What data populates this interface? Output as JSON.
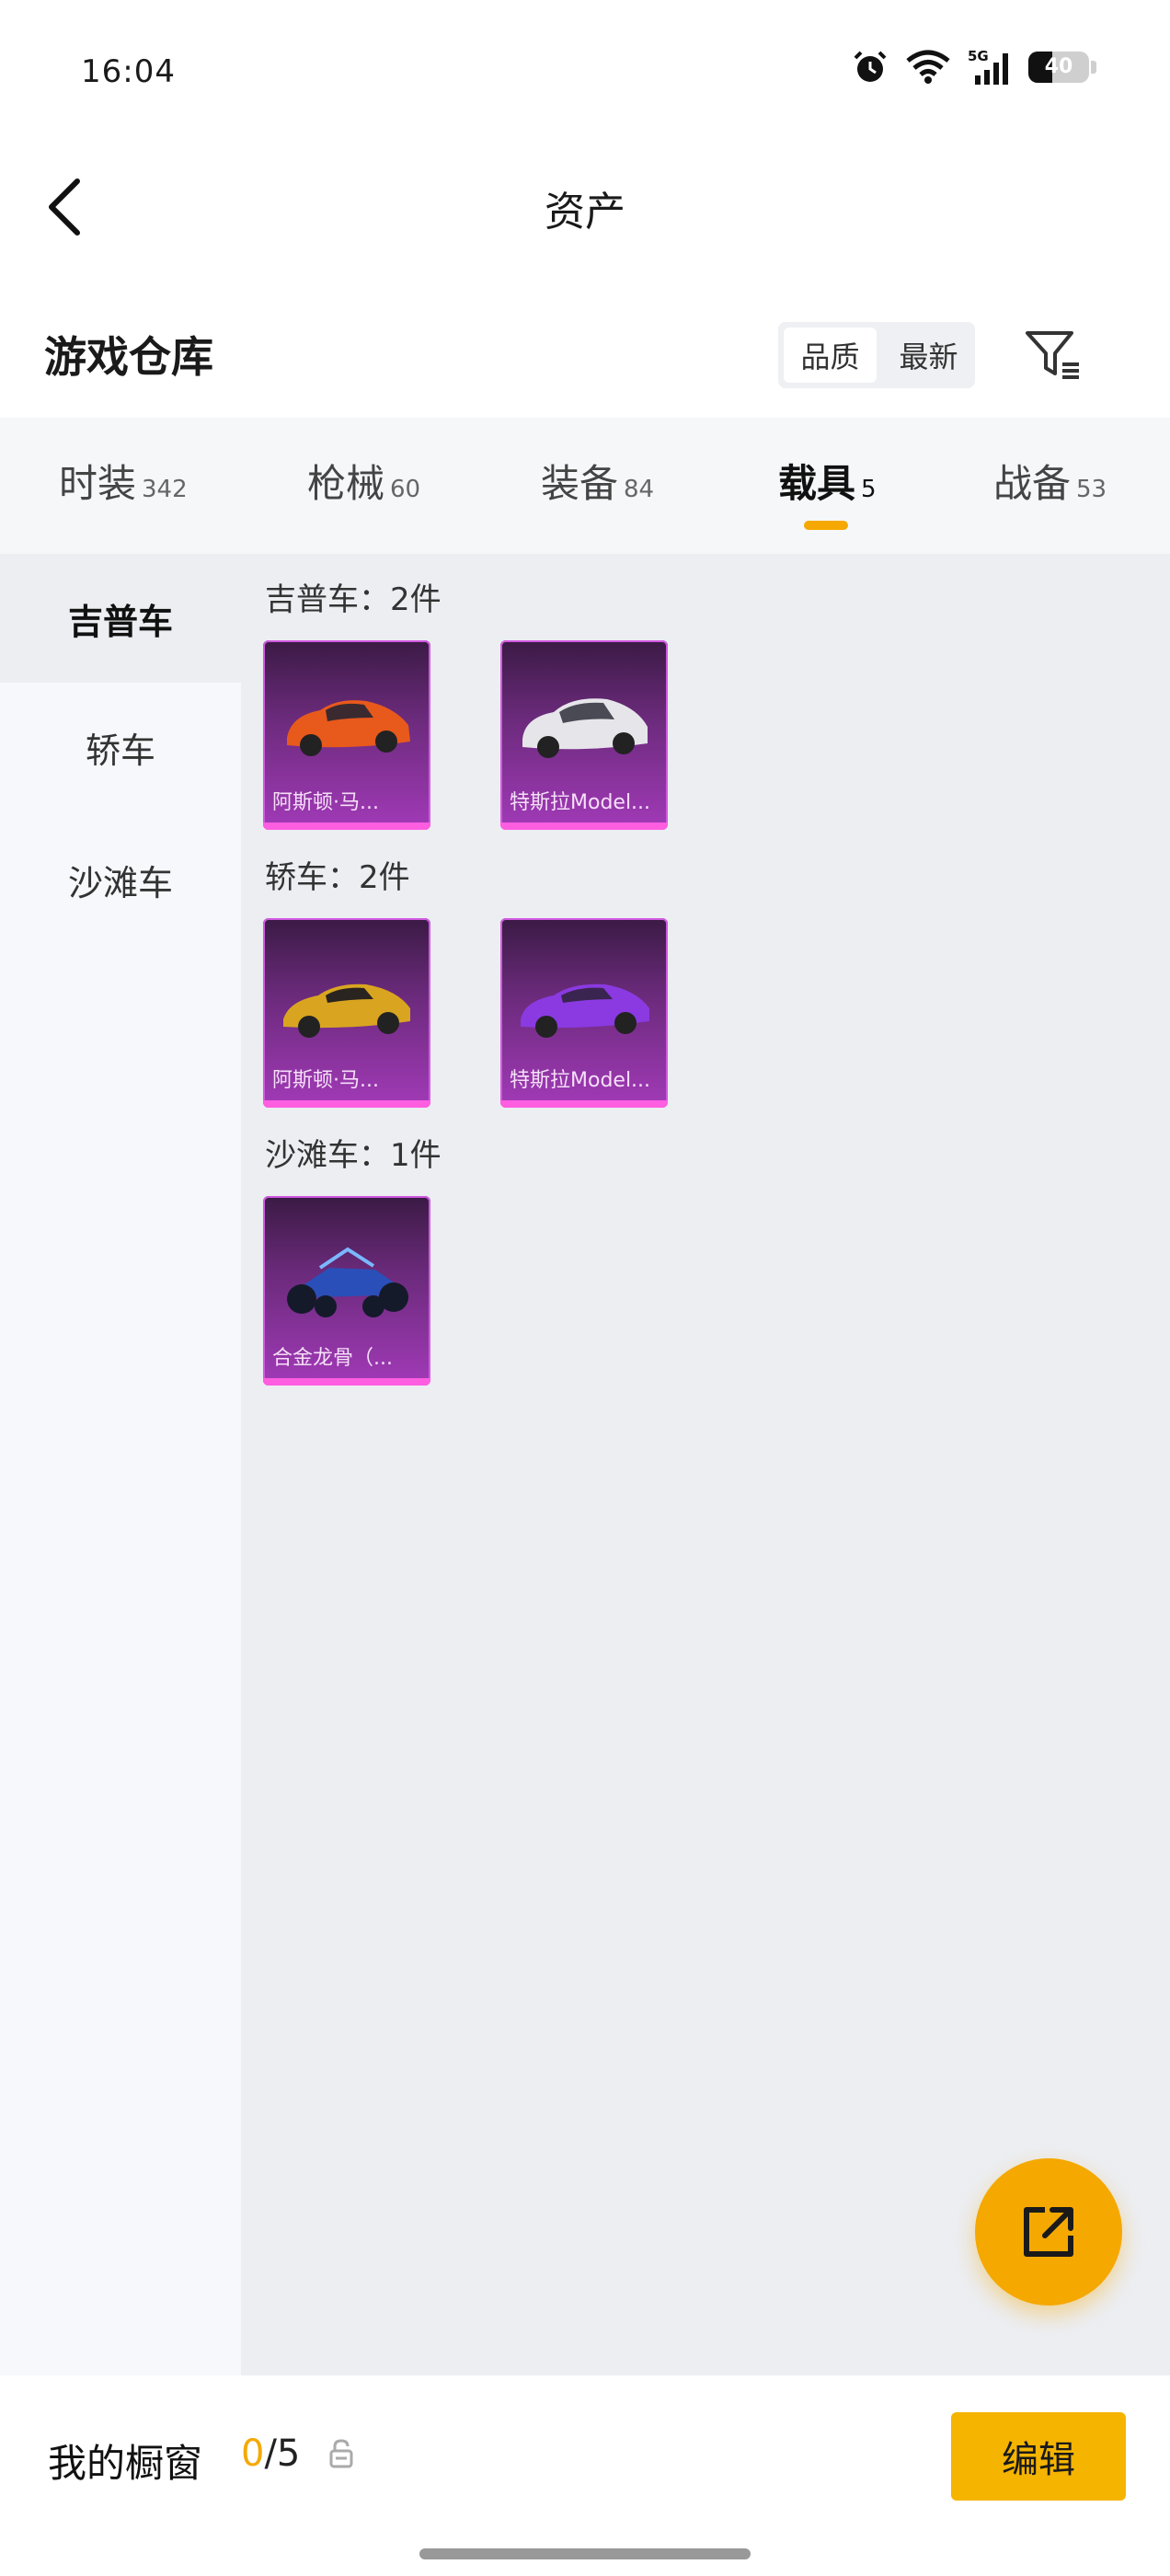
{
  "status": {
    "time": "16:04",
    "battery": "40",
    "network": "5G"
  },
  "header": {
    "title": "资产"
  },
  "warehouse": {
    "title": "游戏仓库",
    "sort_options": [
      "品质",
      "最新"
    ],
    "sort_selected": "品质"
  },
  "tabs": [
    {
      "label": "时装",
      "count": "342"
    },
    {
      "label": "枪械",
      "count": "60"
    },
    {
      "label": "装备",
      "count": "84"
    },
    {
      "label": "载具",
      "count": "5"
    },
    {
      "label": "战备",
      "count": "53"
    }
  ],
  "active_tab": "载具",
  "sidebar": {
    "items": [
      {
        "label": "吉普车"
      },
      {
        "label": "轿车"
      },
      {
        "label": "沙滩车"
      }
    ],
    "active": "吉普车"
  },
  "groups": [
    {
      "title": "吉普车：2件",
      "items": [
        {
          "name": "阿斯顿·马...",
          "icon": "orange-suv-icon",
          "color": "#e8591c"
        },
        {
          "name": "特斯拉Model...",
          "icon": "white-suv-icon",
          "color": "#e6e6ea"
        }
      ]
    },
    {
      "title": "轿车：2件",
      "items": [
        {
          "name": "阿斯顿·马...",
          "icon": "gold-coupe-icon",
          "color": "#d9a520"
        },
        {
          "name": "特斯拉Model...",
          "icon": "purple-sedan-icon",
          "color": "#8a3ae0"
        }
      ]
    },
    {
      "title": "沙滩车：1件",
      "items": [
        {
          "name": "合金龙骨（...",
          "icon": "blue-buggy-icon",
          "color": "#2a4fb8"
        }
      ]
    }
  ],
  "bottom": {
    "showcase_label": "我的橱窗",
    "showcase_current": "0",
    "showcase_total": "/5",
    "edit_label": "编辑"
  },
  "colors": {
    "accent": "#f5a800",
    "card_purple": "#8a2fa0"
  }
}
